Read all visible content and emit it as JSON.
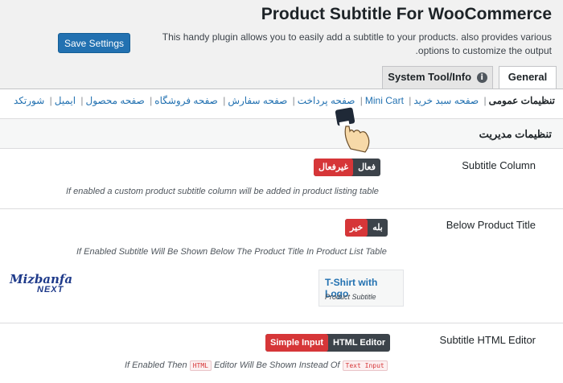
{
  "header": {
    "title": "Product Subtitle For WooCommerce",
    "description": "This handy plugin allows you to easily add a subtitle to your products. also provides various options to customize the output.",
    "save_label": "Save Settings"
  },
  "tabs": [
    {
      "label": "General",
      "active": true
    },
    {
      "label": "System Tool/Info",
      "icon": "info-icon",
      "active": false
    }
  ],
  "subnav": [
    {
      "label": "تنظیمات عمومی",
      "current": true
    },
    {
      "label": "صفحه سبد خرید"
    },
    {
      "label": "Mini Cart"
    },
    {
      "label": "صفحه پرداخت"
    },
    {
      "label": "صفحه سفارش"
    },
    {
      "label": "صفحه فروشگاه"
    },
    {
      "label": "صفحه محصول"
    },
    {
      "label": "ایمیل"
    },
    {
      "label": "شورتکد"
    }
  ],
  "subnav_separator": "|",
  "section": {
    "title": "تنظیمات مدیریت"
  },
  "settings": {
    "subtitle_column": {
      "label": "Subtitle Column",
      "toggle_off": "غیرفعال",
      "toggle_on": "فعال",
      "selected": "غیرفعال",
      "help": "If enabled a custom product subtitle column will be added in product listing table"
    },
    "below_title": {
      "label": "Below Product Title",
      "toggle_no": "خیر",
      "toggle_yes": "بله",
      "selected": "خیر",
      "help": "If Enabled Subtitle Will Be Shown Below The Product Title In Product List Table",
      "preview_title": "T-Shirt with Logo",
      "preview_subtitle": "Product Subtitle"
    },
    "html_editor": {
      "label": "Subtitle HTML Editor",
      "toggle_simple": "Simple Input",
      "toggle_html": "HTML Editor",
      "selected": "Simple Input",
      "help_1": "If Enabled Then",
      "help_tag_1": "HTML",
      "help_2": "Editor Will Be Shown Instead Of",
      "help_tag_2": "Text Input"
    }
  },
  "watermark": {
    "line1": "Mizbanfa",
    "line2": "NEXT"
  },
  "colors": {
    "accent": "#2271b1",
    "toggle_active": "#d63638",
    "toggle_bg": "#3c434a"
  }
}
